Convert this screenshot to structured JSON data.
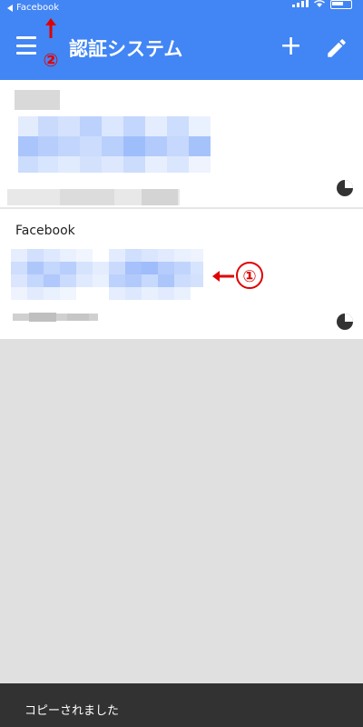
{
  "status_bar": {
    "back_app": "Facebook"
  },
  "appbar": {
    "title": "認証システム",
    "add_symbol": "+"
  },
  "annotations": {
    "marker_1": "①",
    "marker_2": "②"
  },
  "accounts": [
    {
      "name": "",
      "code": "",
      "account_label": ""
    },
    {
      "name": "Facebook",
      "code": "",
      "account_label": ""
    }
  ],
  "snackbar": {
    "message": "コピーされました"
  },
  "colors": {
    "appbar": "#4285f4",
    "annotation": "#e00000",
    "snackbar": "#323232"
  },
  "icons": {
    "menu": "hamburger-icon",
    "add": "plus-icon",
    "edit": "pencil-icon",
    "timer": "timer-pie-icon"
  }
}
